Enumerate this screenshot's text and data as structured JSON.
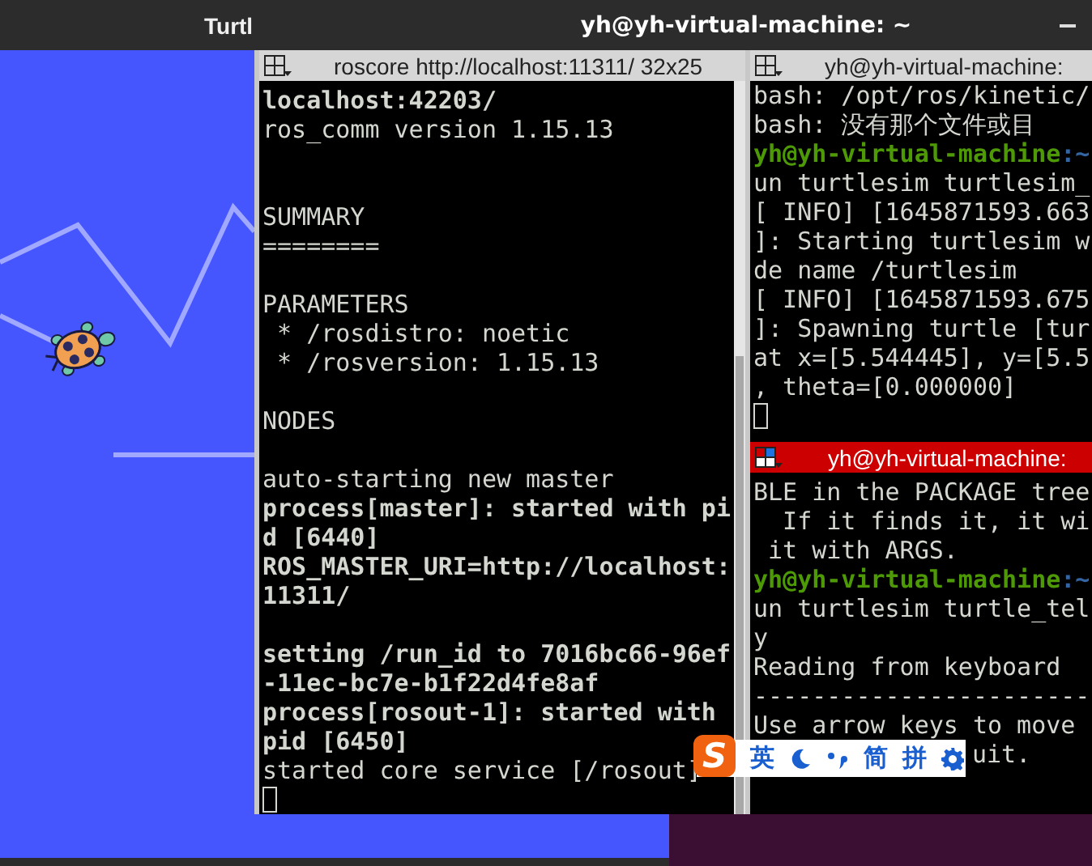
{
  "turtlesim": {
    "title": "Turtl"
  },
  "terminal": {
    "title": "yh@yh-virtual-machine: ~",
    "panes": [
      {
        "title": "roscore http://localhost:11311/ 32x25",
        "focused": false,
        "cursor": true,
        "lines": [
          {
            "kind": "output",
            "text": "localhost:42203/",
            "bold": true
          },
          {
            "kind": "output",
            "text": "ros_comm version 1.15.13",
            "bold": false
          },
          {
            "kind": "blank"
          },
          {
            "kind": "blank"
          },
          {
            "kind": "output",
            "text": "SUMMARY",
            "bold": false
          },
          {
            "kind": "output",
            "text": "========",
            "bold": false
          },
          {
            "kind": "blank"
          },
          {
            "kind": "output",
            "text": "PARAMETERS",
            "bold": false
          },
          {
            "kind": "output",
            "text": " * /rosdistro: noetic",
            "bold": false
          },
          {
            "kind": "output",
            "text": " * /rosversion: 1.15.13",
            "bold": false
          },
          {
            "kind": "blank"
          },
          {
            "kind": "output",
            "text": "NODES",
            "bold": false
          },
          {
            "kind": "blank"
          },
          {
            "kind": "output",
            "text": "auto-starting new master",
            "bold": false
          },
          {
            "kind": "output",
            "text": "process[master]: started with pi",
            "bold": true
          },
          {
            "kind": "output",
            "text": "d [6440]",
            "bold": true
          },
          {
            "kind": "output",
            "text": "ROS_MASTER_URI=http://localhost:",
            "bold": true
          },
          {
            "kind": "output",
            "text": "11311/",
            "bold": true
          },
          {
            "kind": "blank"
          },
          {
            "kind": "output",
            "text": "setting /run_id to 7016bc66-96ef",
            "bold": true
          },
          {
            "kind": "output",
            "text": "-11ec-bc7e-b1f22d4fe8af",
            "bold": true
          },
          {
            "kind": "output",
            "text": "process[rosout-1]: started with",
            "bold": true
          },
          {
            "kind": "output",
            "text": "pid [6450]",
            "bold": true
          },
          {
            "kind": "output",
            "text": "started core service [/rosout]",
            "bold": false
          }
        ]
      },
      {
        "title": "yh@yh-virtual-machine:",
        "focused": false,
        "cursor": true,
        "lines": [
          {
            "kind": "output",
            "text": "bash: /opt/ros/kinetic/",
            "bold": false
          },
          {
            "kind": "output",
            "text": "bash: 没有那个文件或目",
            "bold": false
          },
          {
            "kind": "prompt",
            "user": "yh@yh-virtual-machine",
            "path": ":~"
          },
          {
            "kind": "output",
            "text": "un turtlesim turtlesim_",
            "bold": false
          },
          {
            "kind": "output",
            "text": "[ INFO] [1645871593.663",
            "bold": false
          },
          {
            "kind": "output",
            "text": "]: Starting turtlesim w",
            "bold": false
          },
          {
            "kind": "output",
            "text": "de name /turtlesim",
            "bold": false
          },
          {
            "kind": "output",
            "text": "[ INFO] [1645871593.675",
            "bold": false
          },
          {
            "kind": "output",
            "text": "]: Spawning turtle [tur",
            "bold": false
          },
          {
            "kind": "output",
            "text": "at x=[5.544445], y=[5.5",
            "bold": false
          },
          {
            "kind": "output",
            "text": ", theta=[0.000000]",
            "bold": false
          }
        ]
      },
      {
        "title": "yh@yh-virtual-machine:",
        "focused": true,
        "lines": [
          {
            "kind": "output",
            "text": "BLE in the PACKAGE tree",
            "bold": false
          },
          {
            "kind": "output",
            "text": "  If it finds it, it wi",
            "bold": false
          },
          {
            "kind": "output",
            "text": " it with ARGS.",
            "bold": false
          },
          {
            "kind": "prompt",
            "user": "yh@yh-virtual-machine",
            "path": ":~"
          },
          {
            "kind": "output",
            "text": "un turtlesim turtle_tel",
            "bold": false
          },
          {
            "kind": "output",
            "text": "y",
            "bold": false
          },
          {
            "kind": "output",
            "text": "Reading from keyboard",
            "bold": false
          },
          {
            "kind": "output",
            "text": "-----------------------",
            "bold": false
          },
          {
            "kind": "output",
            "text": "Use arrow keys to move",
            "bold": false
          },
          {
            "kind": "covered",
            "text": "uit.",
            "bold": false
          }
        ]
      }
    ]
  },
  "input_method_bar": {
    "items": [
      {
        "kind": "logo",
        "text": "S"
      },
      {
        "kind": "text",
        "text": "英"
      },
      {
        "kind": "moon"
      },
      {
        "kind": "punctuation"
      },
      {
        "kind": "text",
        "text": "简"
      },
      {
        "kind": "text",
        "text": "拼"
      },
      {
        "kind": "gear"
      }
    ]
  }
}
